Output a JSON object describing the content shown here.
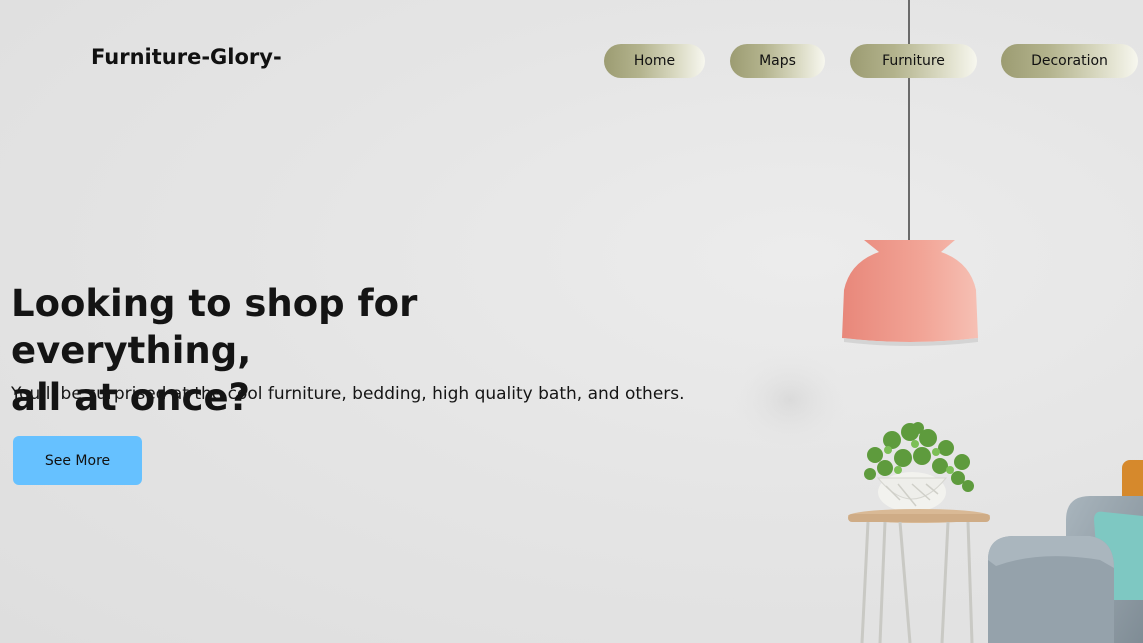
{
  "brand": {
    "name": "Furniture-Glory-"
  },
  "nav": {
    "items": [
      {
        "label": "Home"
      },
      {
        "label": "Maps"
      },
      {
        "label": "Furniture"
      },
      {
        "label": "Decoration"
      }
    ]
  },
  "hero": {
    "title_line1": "Looking to shop for everything,",
    "title_line2": "all at once?",
    "subtitle": "You’ll be surprised at the cool furniture, bedding, high quality bath, and others.",
    "cta_label": "See More"
  },
  "colors": {
    "cta": "#66c1ff",
    "nav_gradient_start": "#9c9c72",
    "nav_gradient_end": "#f7f7ef",
    "lamp": "#ef9a8c",
    "wall": "#e5e5e5"
  }
}
